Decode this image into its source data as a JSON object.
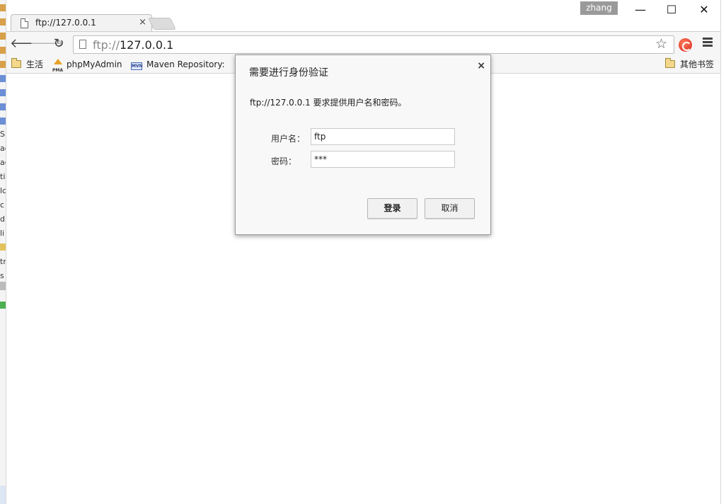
{
  "window": {
    "user_badge": "zhang",
    "minimize_glyph": "—",
    "maximize_glyph": "☐",
    "close_glyph": "✕"
  },
  "tab": {
    "title": "ftp://127.0.0.1",
    "close_glyph": "×"
  },
  "toolbar": {
    "back_glyph": "🡐",
    "forward_glyph": "🡒",
    "reload_glyph": "↻",
    "url_scheme": "ftp://",
    "url_host": "127.0.0.1",
    "star_glyph": "☆",
    "icons": [
      "page-icon",
      "star-icon",
      "extension-icon",
      "menu-icon"
    ]
  },
  "bookmarks": {
    "items": [
      {
        "label": "生活",
        "icon": "folder-icon"
      },
      {
        "label": "phpMyAdmin",
        "icon": "phpmyadmin-icon"
      },
      {
        "label": "Maven Repository: S",
        "icon": "maven-icon"
      }
    ],
    "other_label": "其他书签"
  },
  "left_strip": {
    "fragments": [
      "S",
      "ac",
      "ac",
      "ti",
      "lc",
      "c",
      "d",
      "li",
      "tr",
      "s"
    ]
  },
  "dialog": {
    "title": "需要进行身份验证",
    "close_glyph": "×",
    "message": "ftp://127.0.0.1 要求提供用户名和密码。",
    "username_label": "用户名：",
    "username_value": "ftp",
    "password_label": "密码：",
    "password_value": "***",
    "login_label": "登录",
    "cancel_label": "取消"
  },
  "colors": {
    "dialog_bg": "#f8f8f8",
    "toolbar_bg": "#f6f6f6",
    "user_badge_bg": "#9a9a9a"
  }
}
